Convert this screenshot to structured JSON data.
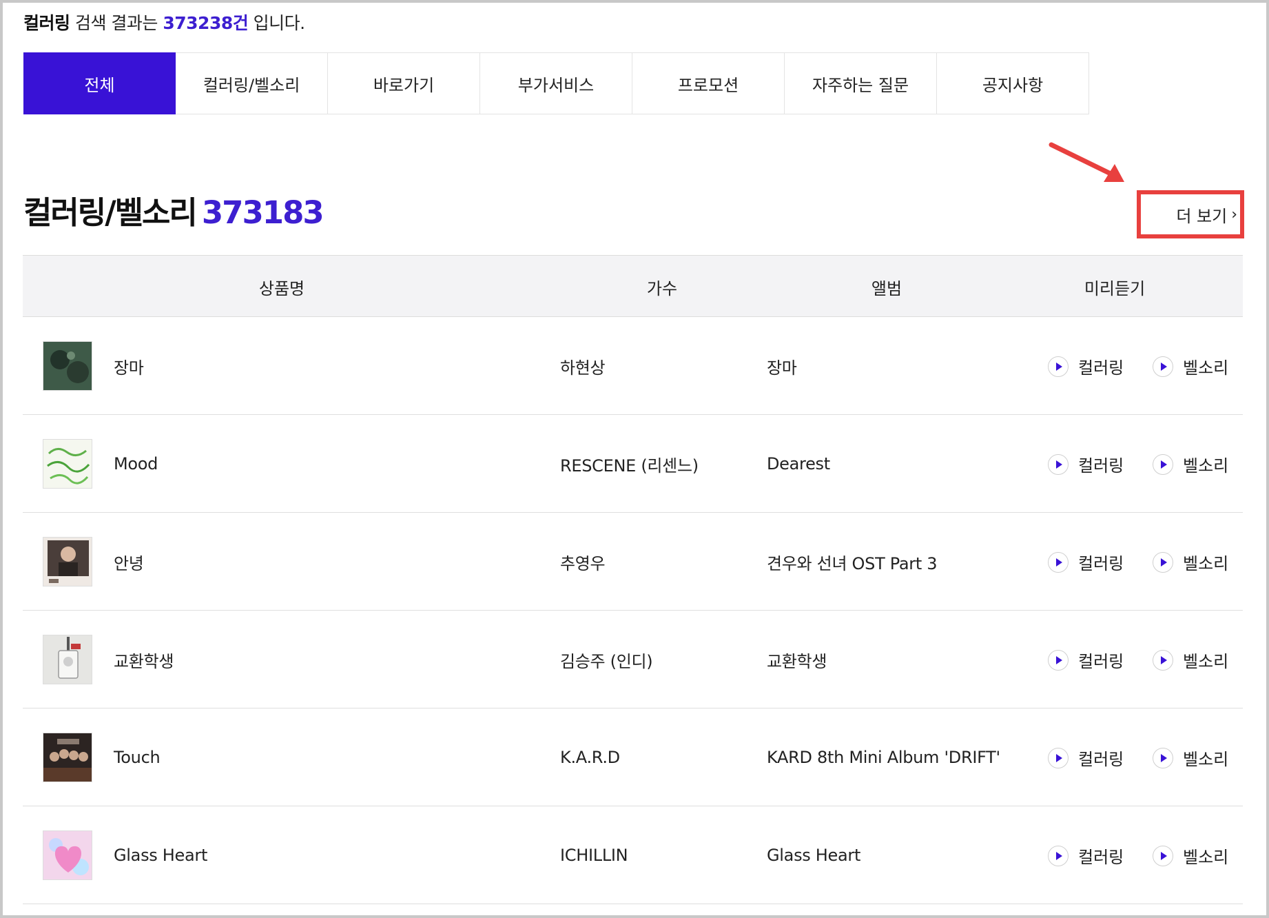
{
  "summary": {
    "keyword": "컬러링",
    "text1": " 검색 결과는 ",
    "count": "373238건",
    "text2": " 입니다."
  },
  "tabs": [
    {
      "label": "전체",
      "active": true
    },
    {
      "label": "컬러링/벨소리"
    },
    {
      "label": "바로가기"
    },
    {
      "label": "부가서비스"
    },
    {
      "label": "프로모션"
    },
    {
      "label": "자주하는 질문"
    },
    {
      "label": "공지사항"
    }
  ],
  "section": {
    "title": "컬러링/벨소리",
    "count": "373183",
    "more_label": "더 보기"
  },
  "table": {
    "headers": [
      "상품명",
      "가수",
      "앨범",
      "미리듣기"
    ],
    "preview_labels": [
      "컬러링",
      "벨소리"
    ],
    "rows": [
      {
        "name": "장마",
        "artist": "하현상",
        "album": "장마"
      },
      {
        "name": "Mood",
        "artist": "RESCENE (리센느)",
        "album": "Dearest"
      },
      {
        "name": "안녕",
        "artist": "추영우",
        "album": "견우와 선녀 OST Part 3"
      },
      {
        "name": "교환학생",
        "artist": "김승주 (인디)",
        "album": "교환학생"
      },
      {
        "name": "Touch",
        "artist": "K.A.R.D",
        "album": "KARD 8th Mini Album 'DRIFT'"
      },
      {
        "name": "Glass Heart",
        "artist": "ICHILLIN",
        "album": "Glass Heart"
      }
    ]
  },
  "colors": {
    "accent": "#3912d6",
    "highlight_box": "#e8403e"
  }
}
